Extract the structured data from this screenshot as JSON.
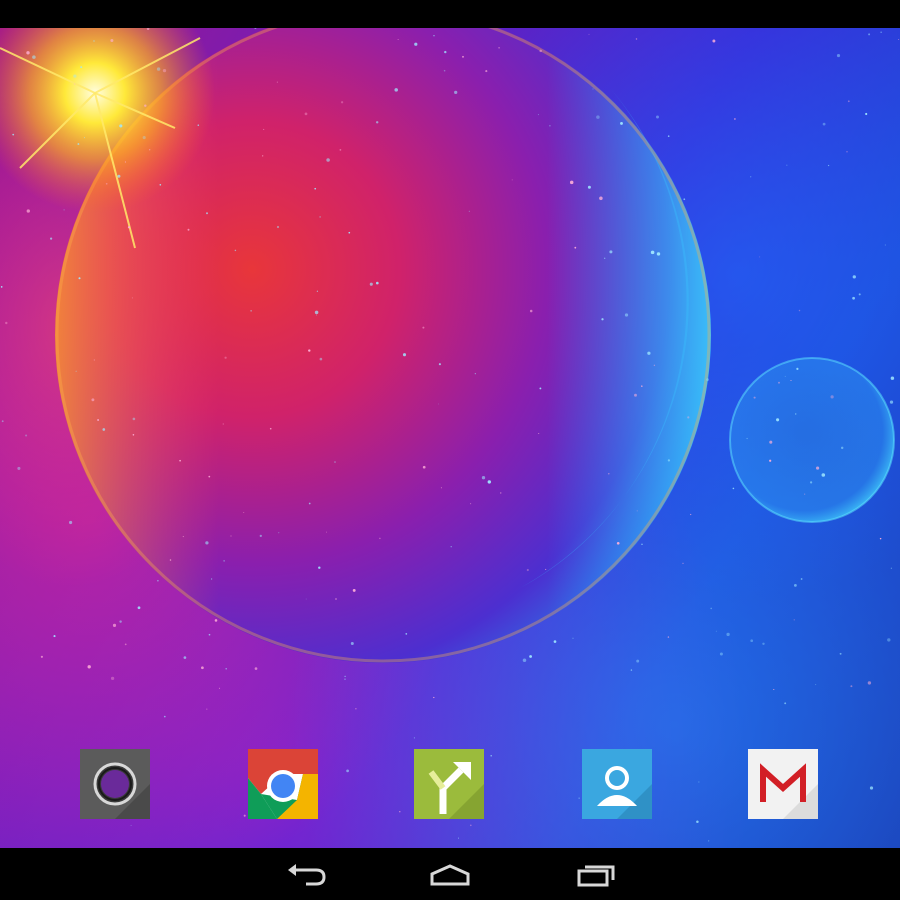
{
  "screen": {
    "type": "android-home-screen",
    "wallpaper": "space-planets-live-wallpaper"
  },
  "dock": {
    "apps": [
      {
        "id": "camera",
        "icon": "camera-icon",
        "color": "#5a5a5a"
      },
      {
        "id": "chrome",
        "icon": "chrome-icon",
        "color": "#db4437"
      },
      {
        "id": "navigation",
        "icon": "navigation-icon",
        "color": "#9bbb3c"
      },
      {
        "id": "people",
        "icon": "contacts-icon",
        "color": "#3aa7e0"
      },
      {
        "id": "gmail",
        "icon": "gmail-icon",
        "color": "#ffffff"
      }
    ]
  },
  "nav_bar": {
    "buttons": [
      {
        "id": "back",
        "icon": "back-icon"
      },
      {
        "id": "home",
        "icon": "home-icon"
      },
      {
        "id": "recents",
        "icon": "recents-icon"
      }
    ]
  },
  "colors": {
    "system_bars": "#000000",
    "nav_icon": "#d8d8d8"
  }
}
